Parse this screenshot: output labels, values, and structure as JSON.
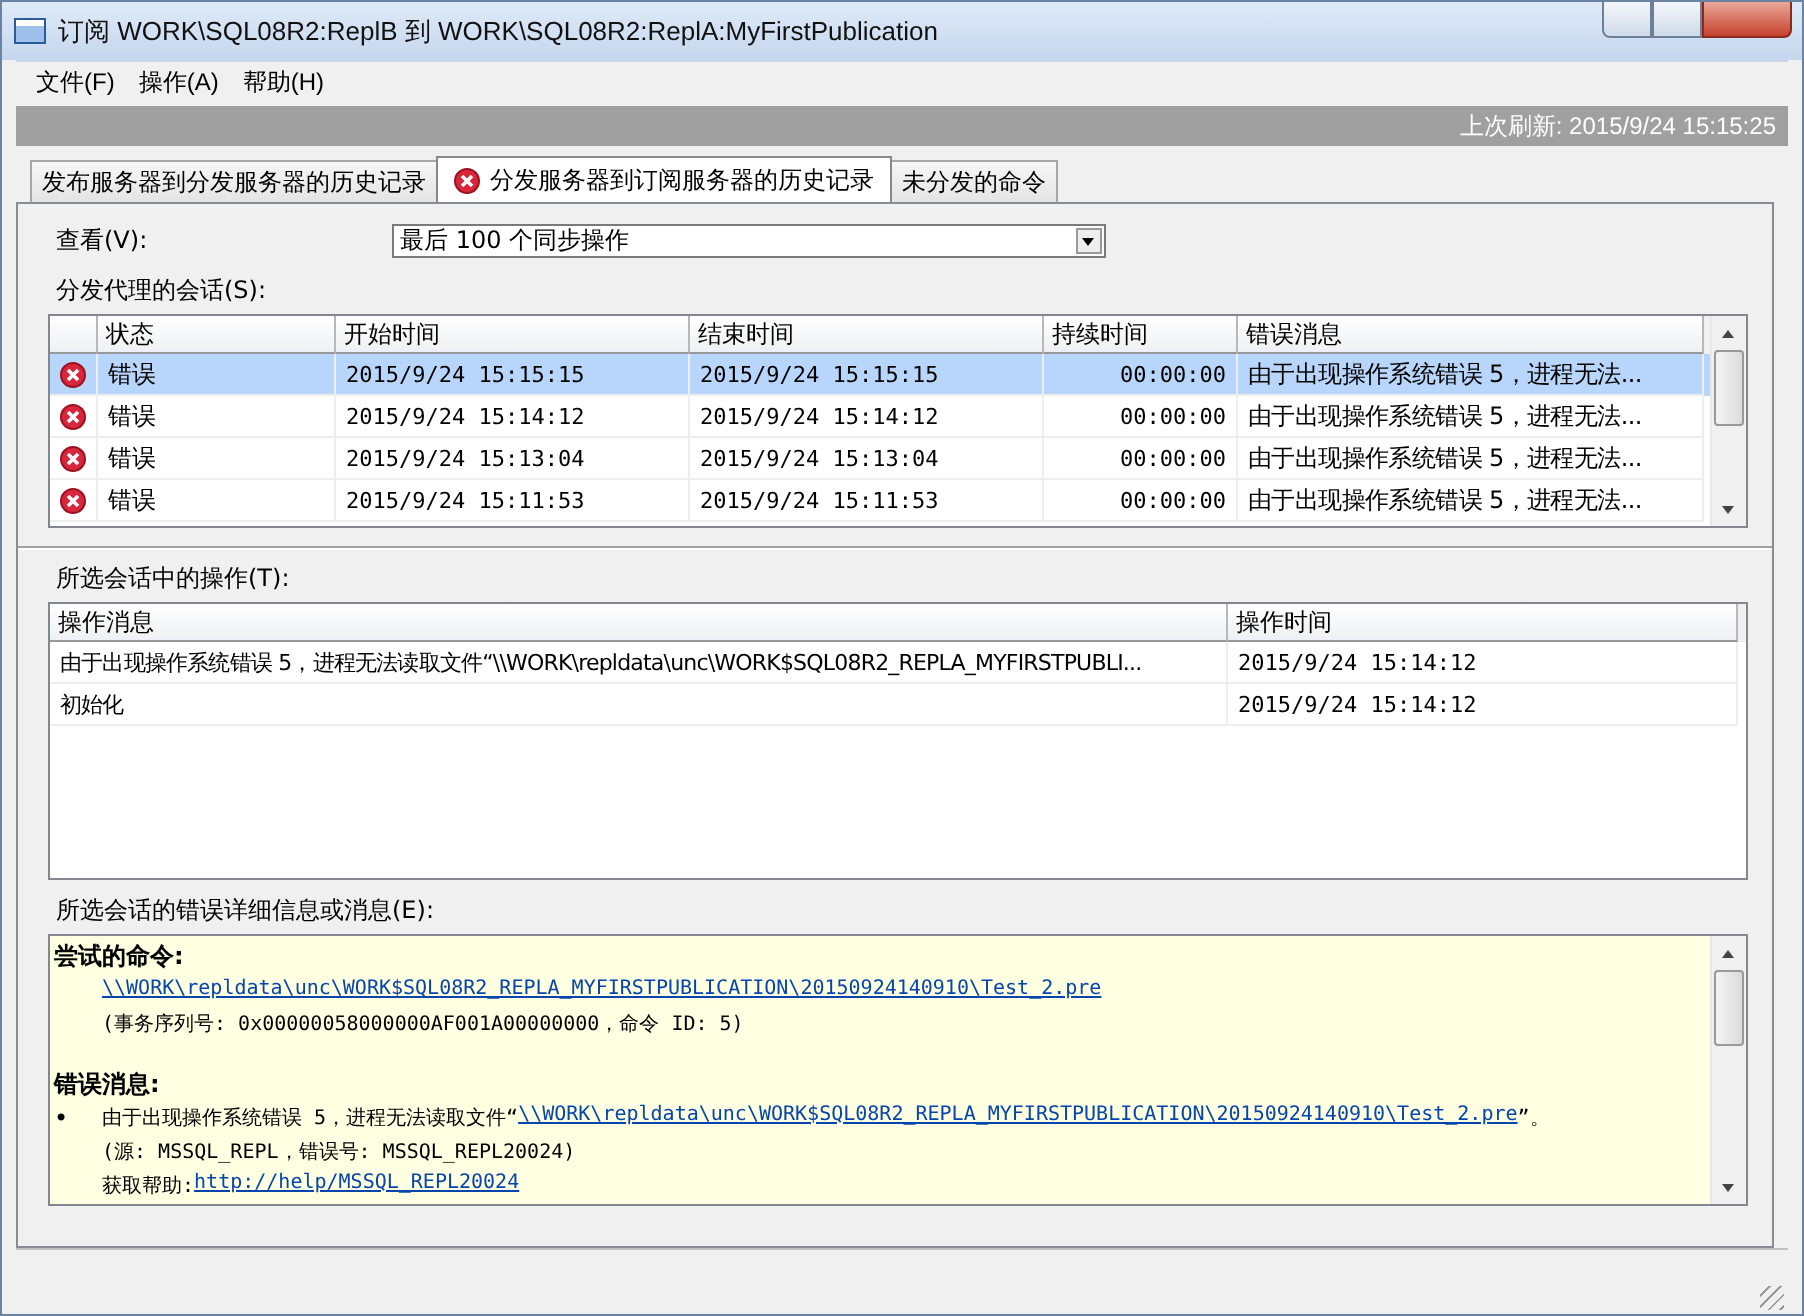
{
  "window": {
    "title": "订阅 WORK\\SQL08R2:ReplB 到 WORK\\SQL08R2:ReplA:MyFirstPublication"
  },
  "menu": [
    "文件(F)",
    "操作(A)",
    "帮助(H)"
  ],
  "refresh_bar": {
    "text": "上次刷新: 2015/9/24 15:15:25"
  },
  "tabs": [
    {
      "label": "发布服务器到分发服务器的历史记录",
      "selected": false,
      "kind": "plain"
    },
    {
      "label": "分发服务器到订阅服务器的历史记录",
      "selected": true,
      "kind": "error"
    },
    {
      "label": "未分发的命令",
      "selected": false,
      "kind": "plain"
    }
  ],
  "view": {
    "label": "查看(V):",
    "value": "最后 100 个同步操作"
  },
  "sessions": {
    "label": "分发代理的会话(S):",
    "columns": [
      "状态",
      "开始时间",
      "结束时间",
      "持续时间",
      "错误消息"
    ],
    "rows": [
      {
        "kind": "error",
        "selected": true,
        "cells": [
          "错误",
          "2015/9/24 15:15:15",
          "2015/9/24 15:15:15",
          "00:00:00",
          "由于出现操作系统错误 5，进程无法..."
        ]
      },
      {
        "kind": "error",
        "selected": false,
        "cells": [
          "错误",
          "2015/9/24 15:14:12",
          "2015/9/24 15:14:12",
          "00:00:00",
          "由于出现操作系统错误 5，进程无法..."
        ]
      },
      {
        "kind": "error",
        "selected": false,
        "cells": [
          "错误",
          "2015/9/24 15:13:04",
          "2015/9/24 15:13:04",
          "00:00:00",
          "由于出现操作系统错误 5，进程无法..."
        ]
      },
      {
        "kind": "error",
        "selected": false,
        "cells": [
          "错误",
          "2015/9/24 15:11:53",
          "2015/9/24 15:11:53",
          "00:00:00",
          "由于出现操作系统错误 5，进程无法..."
        ]
      }
    ]
  },
  "actions": {
    "label": "所选会话中的操作(T):",
    "columns": [
      "操作消息",
      "操作时间"
    ],
    "rows": [
      [
        "由于出现操作系统错误 5，进程无法读取文件“\\\\WORK\\repldata\\unc\\WORK$SQL08R2_REPLA_MYFIRSTPUBLI...",
        "2015/9/24 15:14:12"
      ],
      [
        "初始化",
        "2015/9/24 15:14:12"
      ]
    ]
  },
  "details": {
    "label": "所选会话的错误详细信息或消息(E):",
    "sections": [
      {
        "heading": "尝试的命令:",
        "lines": [
          {
            "parts": [
              {
                "kind": "link",
                "text": "\\\\WORK\\repldata\\unc\\WORK$SQL08R2_REPLA_MYFIRSTPUBLICATION\\20150924140910\\Test_2.pre"
              }
            ]
          },
          {
            "parts": [
              {
                "kind": "text",
                "text": "(事务序列号: 0x00000058000000AF001A00000000，命令 ID: 5)"
              }
            ]
          }
        ]
      },
      {
        "heading": "错误消息:",
        "lines": [
          {
            "bullet": "•",
            "parts": [
              {
                "kind": "text",
                "text": "由于出现操作系统错误 5，进程无法读取文件“"
              },
              {
                "kind": "link",
                "text": "\\\\WORK\\repldata\\unc\\WORK$SQL08R2_REPLA_MYFIRSTPUBLICATION\\20150924140910\\Test_2.pre"
              },
              {
                "kind": "text",
                "text": "”。"
              }
            ]
          },
          {
            "parts": [
              {
                "kind": "text",
                "text": "(源: MSSQL_REPL，错误号: MSSQL_REPL20024)"
              }
            ]
          },
          {
            "parts": [
              {
                "kind": "text",
                "text": "获取帮助: "
              },
              {
                "kind": "link",
                "text": "http://help/MSSQL_REPL20024"
              }
            ]
          }
        ]
      }
    ]
  }
}
